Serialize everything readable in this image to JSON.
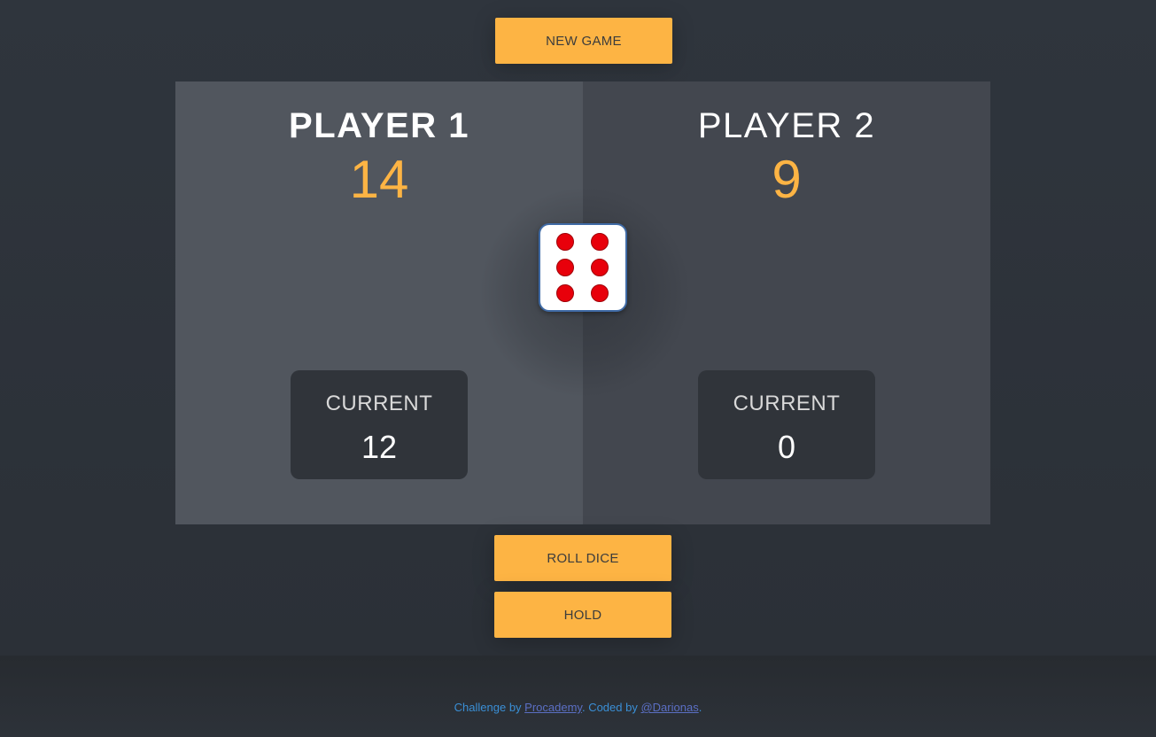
{
  "buttons": {
    "new_game": "NEW GAME",
    "roll_dice": "ROLL DICE",
    "hold": "HOLD"
  },
  "players": [
    {
      "name": "PLAYER 1",
      "score": "14",
      "current_label": "CURRENT",
      "current": "12",
      "active": true
    },
    {
      "name": "PLAYER 2",
      "score": "9",
      "current_label": "CURRENT",
      "current": "0",
      "active": false
    }
  ],
  "dice": {
    "value": 6,
    "icon": "dice-six-icon"
  },
  "footer": {
    "prefix": "Challenge by ",
    "link1": "Procademy",
    "middle": ". Coded by ",
    "link2": "@Darionas",
    "suffix": "."
  },
  "colors": {
    "accent": "#fdb444",
    "pip": "#e8000b",
    "active_panel": "#51565e",
    "inactive_panel": "#43474f",
    "link": "#3a8fd6"
  }
}
